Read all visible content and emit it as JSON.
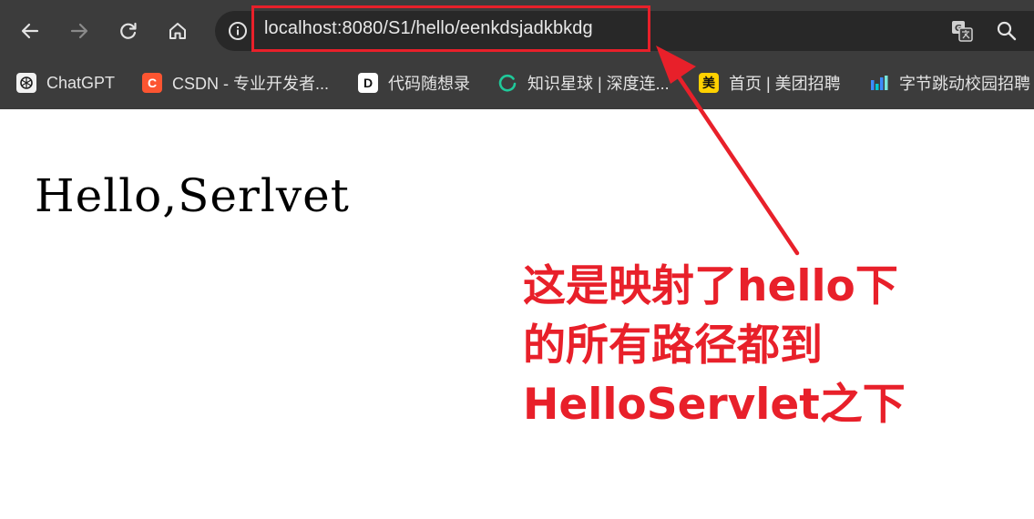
{
  "browser": {
    "url": "localhost:8080/S1/hello/eenkdsjadkbkdg",
    "nav_icons": [
      "back-icon",
      "forward-icon",
      "reload-icon",
      "home-icon"
    ],
    "right_icons": [
      "translate-icon",
      "zoom-icon"
    ]
  },
  "bookmarks": [
    {
      "label": "ChatGPT",
      "icon": "chatgpt-icon"
    },
    {
      "label": "CSDN - 专业开发者...",
      "icon": "csdn-icon",
      "badge": "C"
    },
    {
      "label": "代码随想录",
      "icon": "dmsxl-icon",
      "badge": "D"
    },
    {
      "label": "知识星球 | 深度连...",
      "icon": "zsxq-icon"
    },
    {
      "label": "首页 | 美团招聘",
      "icon": "meituan-icon",
      "badge": "美"
    },
    {
      "label": "字节跳动校园招聘",
      "icon": "bytedance-icon"
    }
  ],
  "page": {
    "text": "Hello,Serlvet"
  },
  "annotation": {
    "lines": [
      "这是映射了hello下",
      "的所有路径都到",
      "HelloServlet之下"
    ]
  },
  "colors": {
    "toolbar_bg": "#3c3c3c",
    "omnibox_bg": "#282828",
    "annotation_red": "#e8202a",
    "page_bg": "#ffffff"
  }
}
